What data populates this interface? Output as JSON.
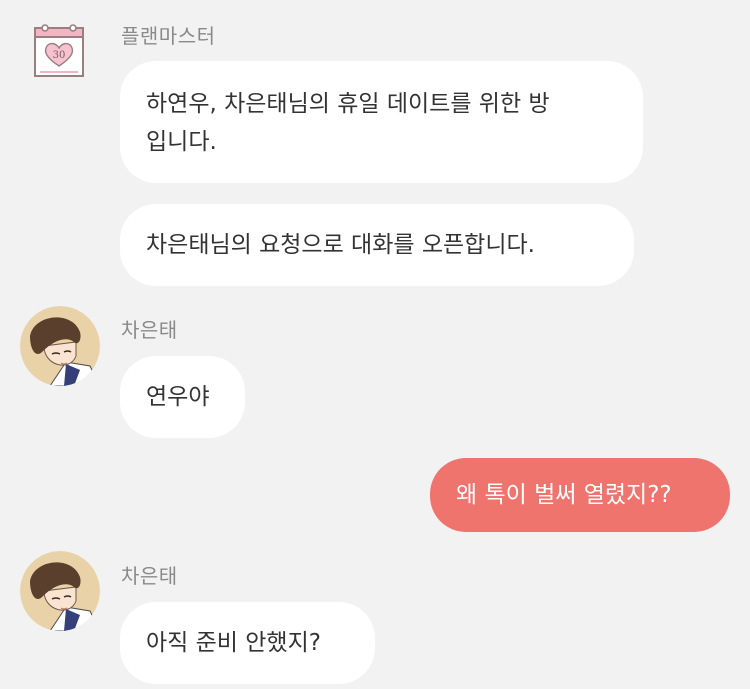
{
  "planner": {
    "name": "플랜마스터",
    "icon": "calendar-heart-icon",
    "icon_text": "30",
    "messages": [
      {
        "lines": [
          "하연우, 차은태님의 휴일 데이트를 위한 방",
          "입니다."
        ]
      },
      {
        "lines": [
          "차은태님의 요청으로 대화를 오픈합니다."
        ]
      }
    ]
  },
  "group1": {
    "name": "차은태",
    "avatar": "character-avatar",
    "message": "연우야"
  },
  "mine": {
    "message": "왜 톡이 벌써 열렸지??"
  },
  "group2": {
    "name": "차은태",
    "avatar": "character-avatar",
    "message": "아직 준비 안했지?"
  },
  "colors": {
    "background": "#f2f2f2",
    "bubble_other": "#ffffff",
    "bubble_mine": "#ee746d",
    "name_text": "#8a8a8a",
    "icon_pink": "#f3b5c4"
  }
}
